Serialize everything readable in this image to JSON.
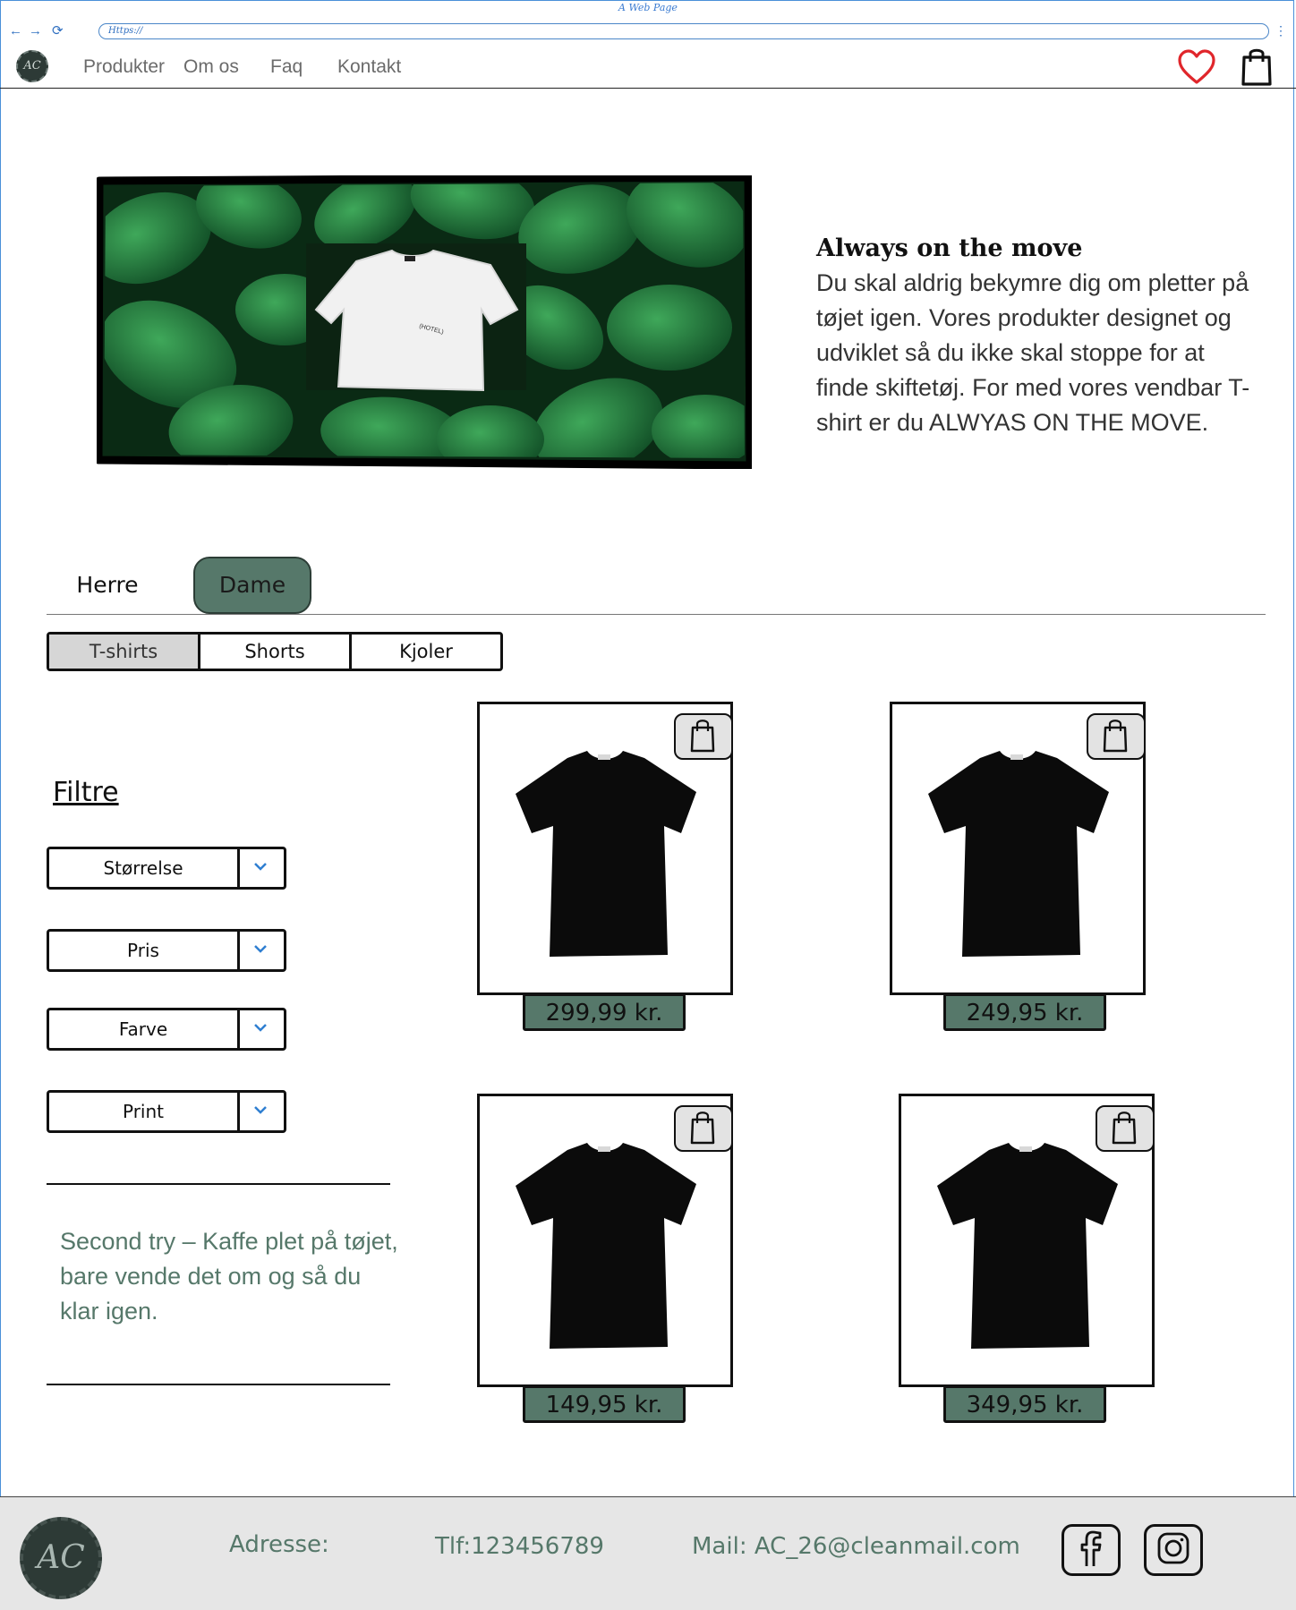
{
  "browser": {
    "window_title": "A Web Page",
    "url": "Https://",
    "back_label": "←",
    "forward_label": "→",
    "reload_label": "⟳",
    "menu_label": "⋮"
  },
  "nav": {
    "logo_text": "AC",
    "links": [
      "Produkter",
      "Om os",
      "Faq",
      "Kontakt"
    ],
    "icons": [
      "heart-icon",
      "shopping-bag-icon"
    ]
  },
  "hero": {
    "title": "Always on the move",
    "body": "Du skal aldrig bekymre dig om pletter på tøjet igen. Vores produkter designet og udviklet så du ikke skal stoppe for at finde skiftetøj. For med vores vendbar T-shirt er du ALWYAS ON THE MOVE.",
    "image_shirt_label": "(HOTEL)"
  },
  "gender_tabs": {
    "items": [
      "Herre",
      "Dame"
    ],
    "active": "Dame"
  },
  "category_tabs": {
    "items": [
      "T-shirts",
      "Shorts",
      "Kjoler"
    ],
    "active": "T-shirts"
  },
  "filters": {
    "title": "Filtre",
    "dropdowns": [
      "Størrelse",
      "Pris",
      "Farve",
      "Print"
    ]
  },
  "promo": {
    "text": "Second try – Kaffe plet på tøjet, bare vende det om og så du klar igen."
  },
  "products": [
    {
      "price": "299,99 kr."
    },
    {
      "price": "249,95 kr."
    },
    {
      "price": "149,95 kr."
    },
    {
      "price": "349,95 kr."
    }
  ],
  "footer": {
    "logo_text": "AC",
    "address": "Adresse:",
    "phone": "Tlf:123456789",
    "mail": "Mail: AC_26@cleanmail.com",
    "social": [
      "facebook-icon",
      "instagram-icon"
    ]
  },
  "colors": {
    "accent_green": "#56786a",
    "footer_bg": "#e6e6e6",
    "heart_red": "#e0262b",
    "chrome_blue": "#2f6fc0"
  }
}
